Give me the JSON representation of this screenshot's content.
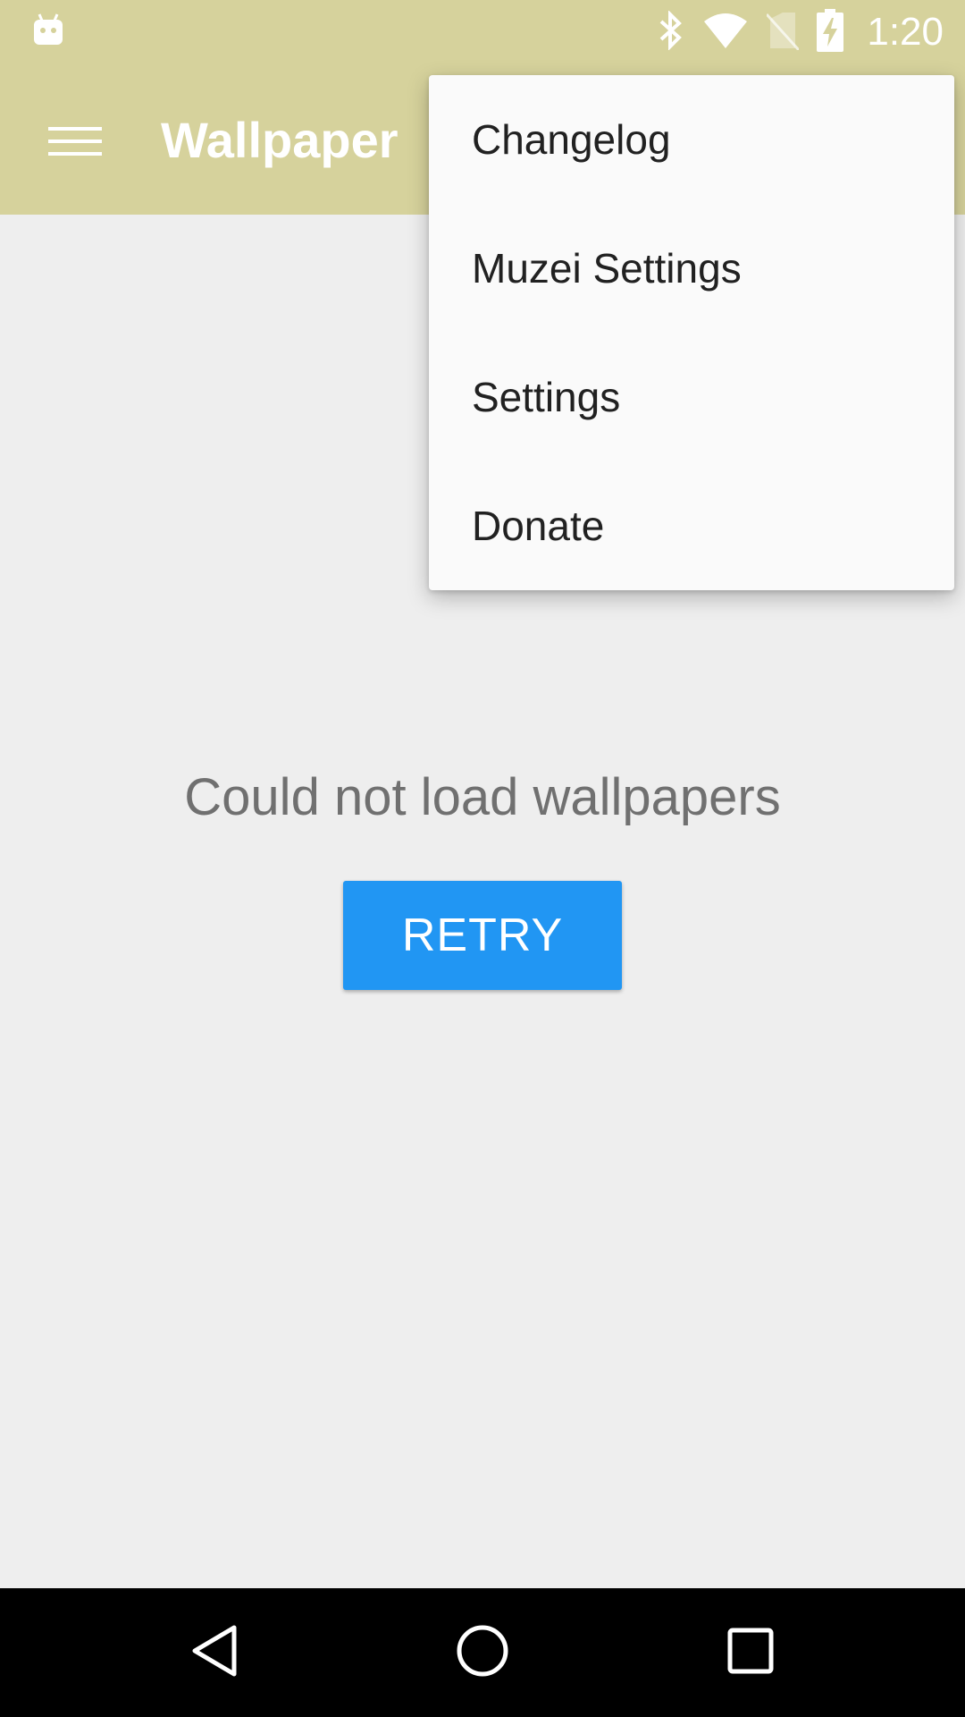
{
  "status_bar": {
    "time": "1:20",
    "icons": [
      "android-notification-icon",
      "bluetooth-icon",
      "wifi-icon",
      "no-sim-icon",
      "battery-charging-icon"
    ]
  },
  "app_bar": {
    "title": "Wallpaper",
    "menu_icon": "hamburger-menu-icon"
  },
  "overflow_menu": {
    "items": [
      {
        "label": "Changelog"
      },
      {
        "label": "Muzei Settings"
      },
      {
        "label": "Settings"
      },
      {
        "label": "Donate"
      }
    ]
  },
  "content": {
    "error_message": "Could not load wallpapers",
    "retry_label": "RETRY"
  },
  "nav_bar": {
    "icons": [
      "back-icon",
      "home-icon",
      "recents-icon"
    ]
  },
  "colors": {
    "app_bar": "#d6d29c",
    "background": "#eeeeee",
    "accent": "#2196f3"
  }
}
